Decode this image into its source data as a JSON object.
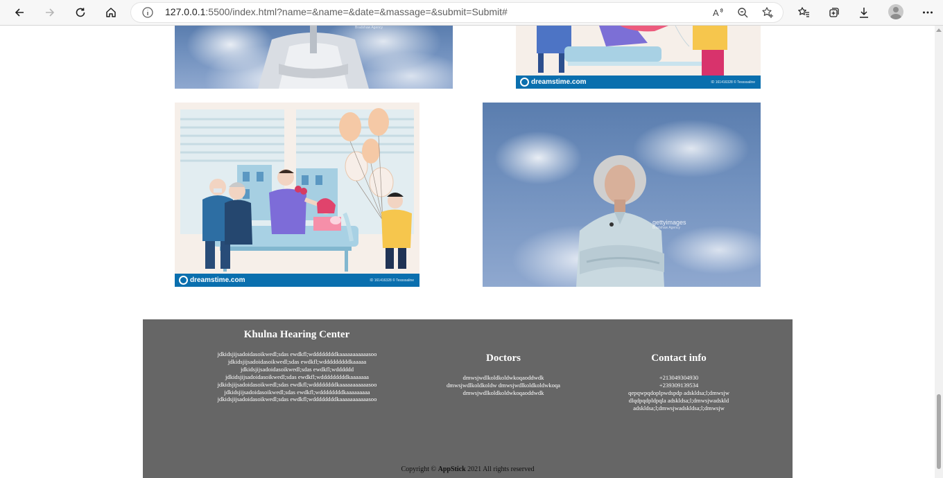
{
  "browser": {
    "url_host": "127.0.0.1",
    "url_rest": ":5500/index.html?name=&name=&date=&massage=&submit=Submit#",
    "read_aloud_label": "A̧"
  },
  "images": {
    "dreamstime_brand": "dreamstime.com",
    "dreamstime_id": "ID 161416328 © Tessssaline",
    "getty_brand": "gettyimages",
    "getty_sub": "Bradshaw Agency"
  },
  "footer": {
    "about": {
      "title": "Khulna Hearing Center",
      "lines": [
        "jdkidsjijsadoidasoikwedl;sdas ewdkfl;wddddddddkaaaaaaaaaaasoo",
        "jdkidsjijsadoidasoikwedl;sdas ewdkfl;wdddddddddkaaaaa",
        "jdkidsjijsadoidasoikwedl;sdas ewdkfl;wdddddd",
        "jdkidsjijsadoidasoikwedl;sdas ewdkfl;wdddddddddkaaaaaaa",
        "jdkidsjijsadoidasoikwedl;sdas ewdkfl;wddddddddkaaaaaaaaaaasoo",
        "jdkidsjijsadoidasoikwedl;sdas ewdkfl;wddddddddkaaaaaaaaa",
        "jdkidsjijsadoidasoikwedl;sdas ewdkfl;wddddddddkaaaaaaaaaaasoo"
      ]
    },
    "doctors": {
      "title": "Doctors",
      "lines": [
        "dmwsjwdlkoldkoldwkoqaoddwdk",
        "dmwsjwdlkoldkoldw dmwsjwdlkoldkoldwkoqa",
        "dmwsjwdlkoldkoldwkoqaoddwdk"
      ]
    },
    "contact": {
      "title": "Contact info",
      "lines": [
        "+213049304930",
        "+239309139534",
        "qepqwpqdoplpwdspdp adskldsa;l;dmwsjw",
        "dlqdpqdpldpqla adskldsa;l;dmwsjwadskld",
        "adskldsa;l;dmwsjwadskldsa;l;dmwsjw"
      ]
    },
    "copyright": {
      "prefix": "Copyright © ",
      "brand": "AppStick",
      "suffix": " 2021 All rights reserved"
    }
  }
}
